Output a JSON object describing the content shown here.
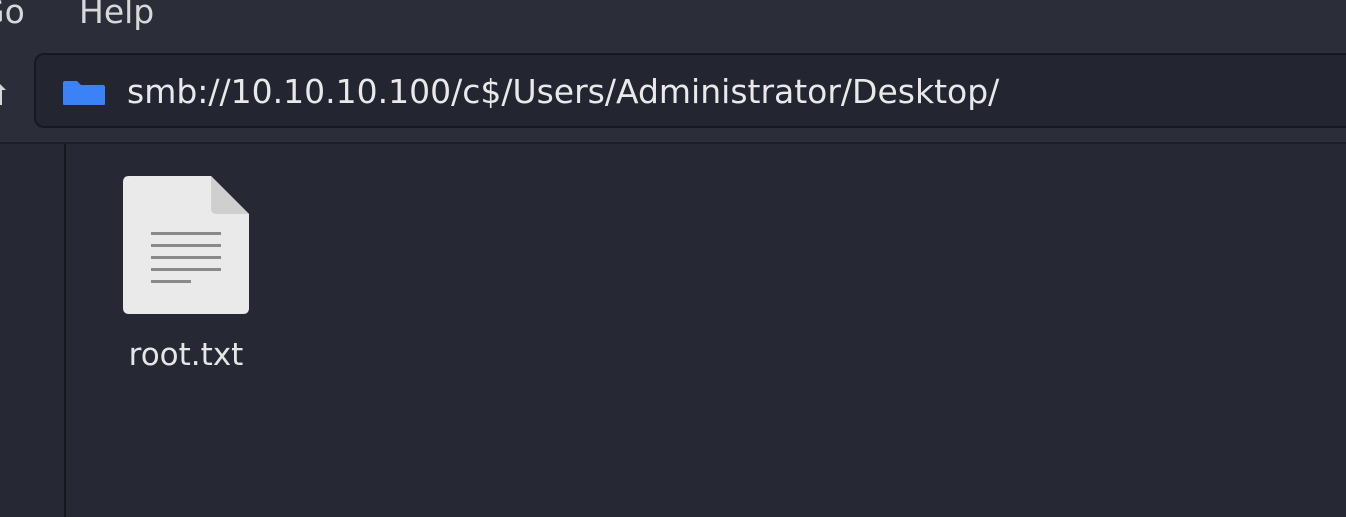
{
  "menubar": {
    "items": [
      "Go",
      "Help"
    ]
  },
  "toolbar": {
    "location": {
      "path": "smb://10.10.10.100/c$/Users/Administrator/Desktop/"
    }
  },
  "files": [
    {
      "name": "root.txt",
      "icon": "text-file-icon"
    }
  ],
  "colors": {
    "background": "#262833",
    "toolbar": "#2b2d39",
    "folder_accent": "#3b82f6",
    "file_icon": "#eaeaea"
  }
}
